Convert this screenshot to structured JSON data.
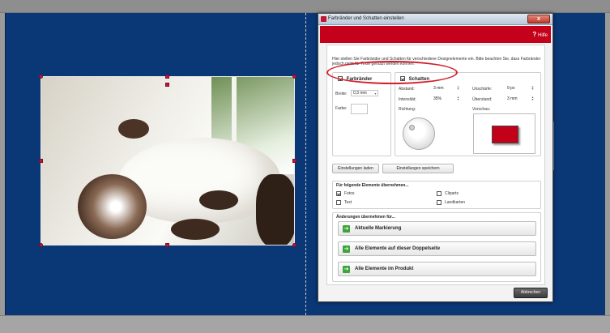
{
  "dialog": {
    "title": "Farbränder und Schatten einstellen",
    "close_label": "x",
    "help_label": "Hilfe",
    "help_glyph": "?",
    "intro": "Hier stellen Sie Farbränder und Schatten für verschiedene Designelemente ein. Bitte beachten Sie, dass Farbränder jedoch nicht für Texte genutzt werden können.",
    "farbraender": {
      "label": "Farbränder",
      "checked": true,
      "breite_label": "Breite:",
      "breite_value": "0,3 mm",
      "farbe_label": "Farbe:"
    },
    "schatten": {
      "label": "Schatten",
      "checked": true,
      "abstand_label": "Abstand:",
      "abstand_value": "3 mm",
      "intensitaet_label": "Intensität:",
      "intensitaet_value": "35%",
      "richtung_label": "Richtung:",
      "unschaerfe_label": "Unschärfe:",
      "unschaerfe_value": "9 px",
      "ueberstand_label": "Überstand:",
      "ueberstand_value": "3 mm",
      "vorschau_label": "Vorschau:"
    },
    "load_button": "Einstellungen laden",
    "save_button": "Einstellungen speichern",
    "apply_section": {
      "title": "Für folgende Elemente übernehmen...",
      "options": [
        {
          "label": "Fotos",
          "checked": true
        },
        {
          "label": "Cliparts",
          "checked": false
        },
        {
          "label": "Text",
          "checked": false
        },
        {
          "label": "Landkarten",
          "checked": false
        }
      ]
    },
    "changes_section": {
      "title": "Änderungen übernehmen für...",
      "buttons": [
        "Aktuelle Markierung",
        "Alle Elemente auf dieser Doppelseite",
        "Alle Elemente im Produkt"
      ]
    },
    "cancel_button": "Abbrechen"
  },
  "colors": {
    "canvas": "#0a3776",
    "accent": "#c4001a",
    "annotation": "#d0212c"
  }
}
